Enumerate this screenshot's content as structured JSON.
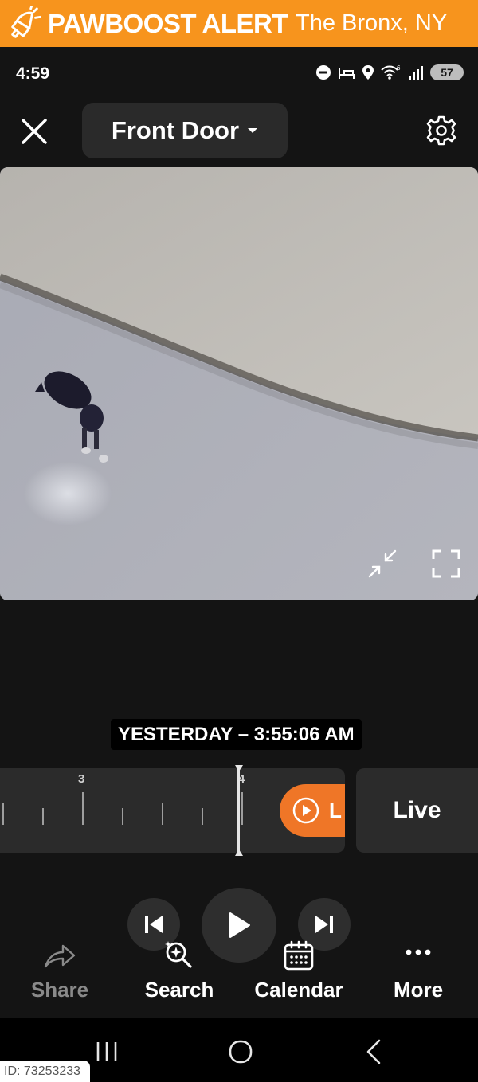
{
  "alert": {
    "brand": "PAWBOOST ALERT",
    "location": "The Bronx, NY",
    "color": "#f7941d"
  },
  "status_bar": {
    "time": "4:59",
    "battery": "57",
    "signal_tag": "6",
    "icons": [
      "do-not-disturb-icon",
      "sleep-icon",
      "location-icon",
      "wifi-icon",
      "signal-icon",
      "battery-icon"
    ]
  },
  "header": {
    "camera_name": "Front Door",
    "close_icon": "close-icon",
    "settings_icon": "gear-icon"
  },
  "video": {
    "controls": [
      "minimize-icon",
      "fullscreen-icon"
    ]
  },
  "timeline": {
    "timestamp": "YESTERDAY – 3:55:06 AM",
    "tick_labels": [
      "3",
      "4"
    ],
    "live_pill_text": "L",
    "live_label": "Live",
    "accent": "#ef7627"
  },
  "playback": {
    "buttons": [
      "skip-previous-icon",
      "play-icon",
      "skip-next-icon"
    ]
  },
  "actions": [
    {
      "label": "Share",
      "icon": "share-icon",
      "enabled": false
    },
    {
      "label": "Search",
      "icon": "search-sparkle-icon",
      "enabled": true
    },
    {
      "label": "Calendar",
      "icon": "calendar-icon",
      "enabled": true
    },
    {
      "label": "More",
      "icon": "more-icon",
      "enabled": true
    }
  ],
  "nav": [
    "recents-icon",
    "home-icon",
    "back-icon"
  ],
  "watermark": "ID: 73253233"
}
